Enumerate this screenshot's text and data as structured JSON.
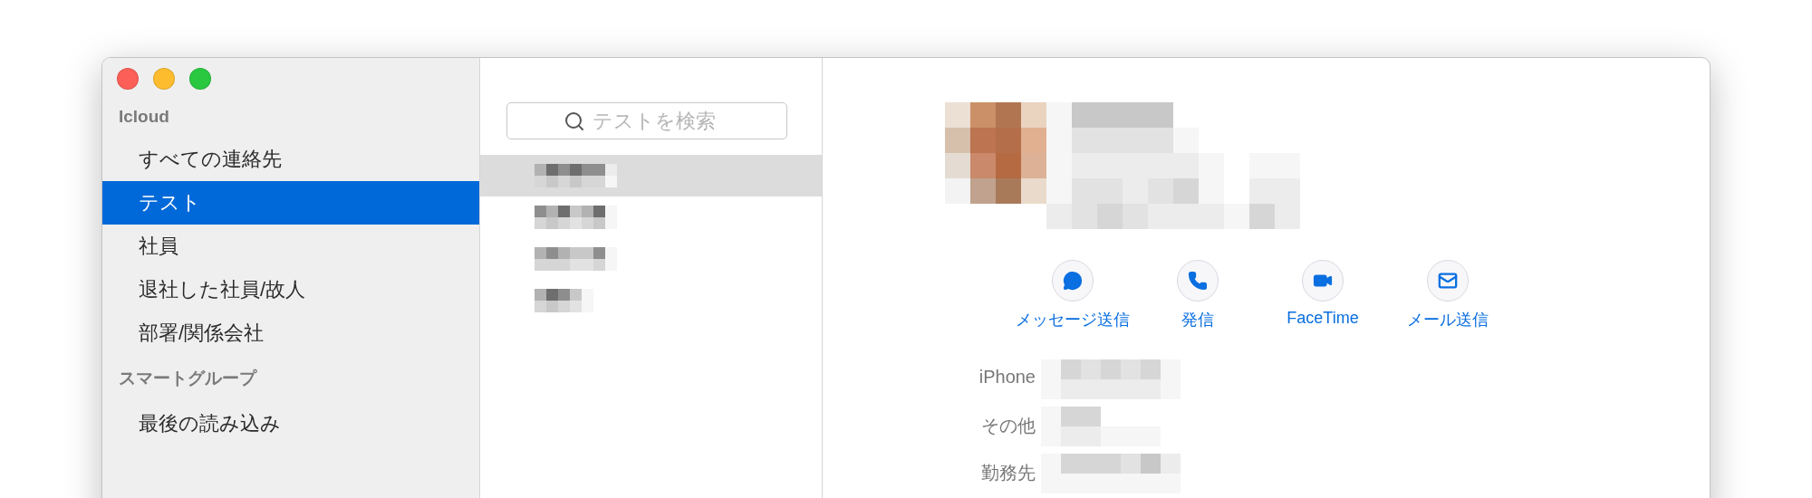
{
  "sidebar": {
    "sections": [
      {
        "header": "Icloud",
        "items": [
          {
            "label": "すべての連絡先",
            "selected": false
          },
          {
            "label": "テスト",
            "selected": true
          },
          {
            "label": "社員",
            "selected": false
          },
          {
            "label": "退社した社員/故人",
            "selected": false
          },
          {
            "label": "部署/関係会社",
            "selected": false
          }
        ]
      },
      {
        "header": "スマートグループ",
        "items": [
          {
            "label": "最後の読み込み",
            "selected": false
          }
        ]
      }
    ]
  },
  "contacts": {
    "search": {
      "placeholder": "テストを検索"
    },
    "rows": [
      {
        "selected": true
      },
      {
        "selected": false
      },
      {
        "selected": false
      },
      {
        "selected": false
      }
    ]
  },
  "detail": {
    "actions": [
      {
        "kind": "message",
        "label": "メッセージ送信"
      },
      {
        "kind": "call",
        "label": "発信"
      },
      {
        "kind": "video",
        "label": "FaceTime"
      },
      {
        "kind": "mail",
        "label": "メール送信"
      }
    ],
    "fields": [
      {
        "label": "iPhone"
      },
      {
        "label": "その他"
      },
      {
        "label": "勤務先"
      }
    ]
  }
}
